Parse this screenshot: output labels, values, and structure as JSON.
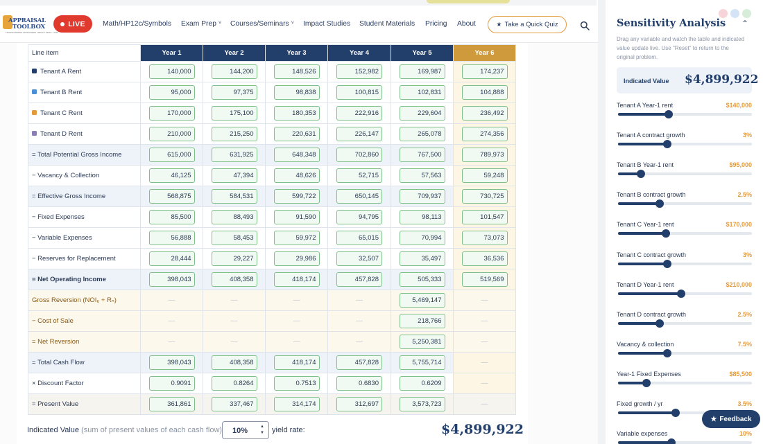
{
  "brand": {
    "logo_line1": "APPRAISAL",
    "logo_line2": "TOOLBOX",
    "logo_sub": "TRANSFORMING APPRAISERS. IMPACT FIRST. 1 MIN."
  },
  "header": {
    "live_label": "LIVE",
    "nav": [
      {
        "label": "Math/HP12c/Symbols",
        "dropdown": false
      },
      {
        "label": "Exam Prep",
        "dropdown": true
      },
      {
        "label": "Courses/Seminars",
        "dropdown": true
      },
      {
        "label": "Impact Studies",
        "dropdown": false
      },
      {
        "label": "Student Materials",
        "dropdown": false
      },
      {
        "label": "Pricing",
        "dropdown": false
      },
      {
        "label": "About",
        "dropdown": false
      }
    ],
    "quiz_label": "Take a Quick Quiz",
    "accent": "#e39a3b",
    "live_color": "#e03a2f"
  },
  "table": {
    "col_header": "Line item",
    "years": [
      "Year 1",
      "Year 2",
      "Year 3",
      "Year 4",
      "Year 5",
      "Year 6"
    ],
    "rows": [
      {
        "label": "Tenant A Rent",
        "kind": "tenant",
        "color": "#223f6b",
        "values": [
          "140,000",
          "144,200",
          "148,526",
          "152,982",
          "169,987",
          "174,237"
        ]
      },
      {
        "label": "Tenant B Rent",
        "kind": "tenant",
        "color": "#4a90d9",
        "values": [
          "95,000",
          "97,375",
          "98,838",
          "100,815",
          "102,831",
          "104,888"
        ]
      },
      {
        "label": "Tenant C Rent",
        "kind": "tenant",
        "color": "#e39a3b",
        "values": [
          "170,000",
          "175,100",
          "180,353",
          "222,916",
          "229,604",
          "236,492"
        ]
      },
      {
        "label": "Tenant D Rent",
        "kind": "tenant",
        "color": "#8a7fb5",
        "values": [
          "210,000",
          "215,250",
          "220,631",
          "226,147",
          "265,078",
          "274,356"
        ]
      },
      {
        "label": "= Total Potential Gross Income",
        "kind": "sum",
        "values": [
          "615,000",
          "631,925",
          "648,348",
          "702,860",
          "767,500",
          "789,973"
        ]
      },
      {
        "label": "− Vacancy & Collection",
        "kind": "plain",
        "values": [
          "46,125",
          "47,394",
          "48,626",
          "52,715",
          "57,563",
          "59,248"
        ]
      },
      {
        "label": "= Effective Gross Income",
        "kind": "sum",
        "values": [
          "568,875",
          "584,531",
          "599,722",
          "650,145",
          "709,937",
          "730,725"
        ]
      },
      {
        "label": "− Fixed Expenses",
        "kind": "plain",
        "values": [
          "85,500",
          "88,493",
          "91,590",
          "94,795",
          "98,113",
          "101,547"
        ]
      },
      {
        "label": "− Variable Expenses",
        "kind": "plain",
        "values": [
          "56,888",
          "58,453",
          "59,972",
          "65,015",
          "70,994",
          "73,073"
        ]
      },
      {
        "label": "− Reserves for Replacement",
        "kind": "plain",
        "values": [
          "28,444",
          "29,227",
          "29,986",
          "32,507",
          "35,497",
          "36,536"
        ]
      },
      {
        "label": "= Net Operating Income",
        "kind": "sumbold",
        "values": [
          "398,043",
          "408,358",
          "418,174",
          "457,828",
          "505,333",
          "519,569"
        ]
      },
      {
        "label": "Gross Reversion (NOI₆ + Rₙ)",
        "kind": "rev",
        "values": [
          "—",
          "—",
          "—",
          "—",
          "5,469,147",
          "—"
        ]
      },
      {
        "label": "− Cost of Sale",
        "kind": "rev",
        "values": [
          "—",
          "—",
          "—",
          "—",
          "218,766",
          "—"
        ]
      },
      {
        "label": "= Net Reversion",
        "kind": "rev",
        "values": [
          "—",
          "—",
          "—",
          "—",
          "5,250,381",
          "—"
        ]
      },
      {
        "label": "= Total Cash Flow",
        "kind": "sum",
        "values": [
          "398,043",
          "408,358",
          "418,174",
          "457,828",
          "5,755,714",
          "—"
        ]
      },
      {
        "label": "× Discount Factor",
        "kind": "plain",
        "values": [
          "0.9091",
          "0.8264",
          "0.7513",
          "0.6830",
          "0.6209",
          "—"
        ]
      },
      {
        "label": "= Present Value",
        "kind": "pv",
        "values": [
          "361,861",
          "337,467",
          "314,174",
          "312,697",
          "3,573,723",
          "—"
        ]
      }
    ]
  },
  "bottom": {
    "label": "Indicated Value",
    "label_muted": "(sum of present values of each cash flow) at",
    "rate": "10%",
    "yield_label": "yield rate:",
    "value": "$4,899,922"
  },
  "sidebar": {
    "title": "Sensitivity Analysis",
    "description": "Drag any variable and watch the table and indicated value update live. Use \"Reset\" to return to the original problem.",
    "iv_label": "Indicated Value",
    "iv_value": "$4,899,922",
    "sliders": [
      {
        "label": "Tenant A Year-1 rent",
        "value": "$140,000",
        "fraction": 0.38
      },
      {
        "label": "Tenant A contract growth",
        "value": "3%",
        "fraction": 0.37
      },
      {
        "label": "Tenant B Year-1 rent",
        "value": "$95,000",
        "fraction": 0.17
      },
      {
        "label": "Tenant B contract growth",
        "value": "2.5%",
        "fraction": 0.31
      },
      {
        "label": "Tenant C Year-1 rent",
        "value": "$170,000",
        "fraction": 0.36
      },
      {
        "label": "Tenant C contract growth",
        "value": "3%",
        "fraction": 0.37
      },
      {
        "label": "Tenant D Year-1 rent",
        "value": "$210,000",
        "fraction": 0.47
      },
      {
        "label": "Tenant D contract growth",
        "value": "2.5%",
        "fraction": 0.31
      },
      {
        "label": "Vacancy & collection",
        "value": "7.5%",
        "fraction": 0.37
      },
      {
        "label": "Year-1 Fixed Expenses",
        "value": "$85,500",
        "fraction": 0.21
      },
      {
        "label": "Fixed growth / yr",
        "value": "3.5%",
        "fraction": 0.43
      },
      {
        "label": "Variable expenses",
        "value": "10%",
        "fraction": 0.4
      }
    ],
    "feedback_label": "Feedback",
    "dot_colors": [
      "#f7d4d8",
      "#d5e3f6",
      "#d7ecd9"
    ]
  }
}
